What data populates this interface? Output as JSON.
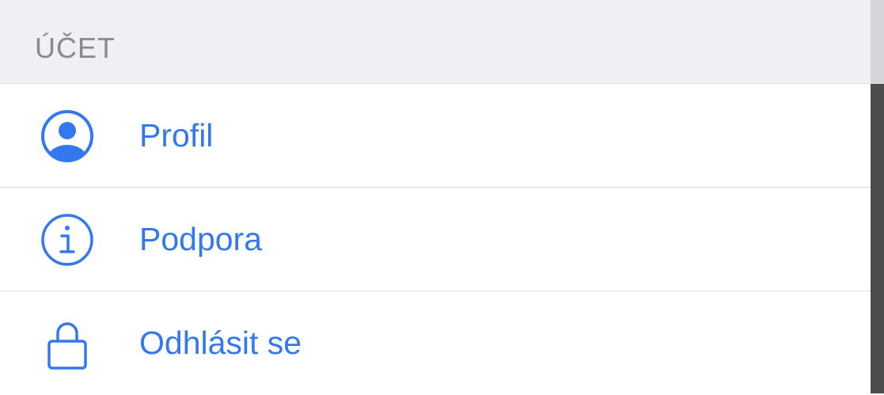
{
  "section": {
    "title": "ÚČET"
  },
  "menu": {
    "items": [
      {
        "label": "Profil",
        "icon": "profile-icon"
      },
      {
        "label": "Podpora",
        "icon": "info-icon"
      },
      {
        "label": "Odhlásit se",
        "icon": "lock-icon"
      }
    ]
  },
  "colors": {
    "accent": "#3478f0",
    "header_background": "#efeff4",
    "header_text": "#8a8a8e"
  }
}
